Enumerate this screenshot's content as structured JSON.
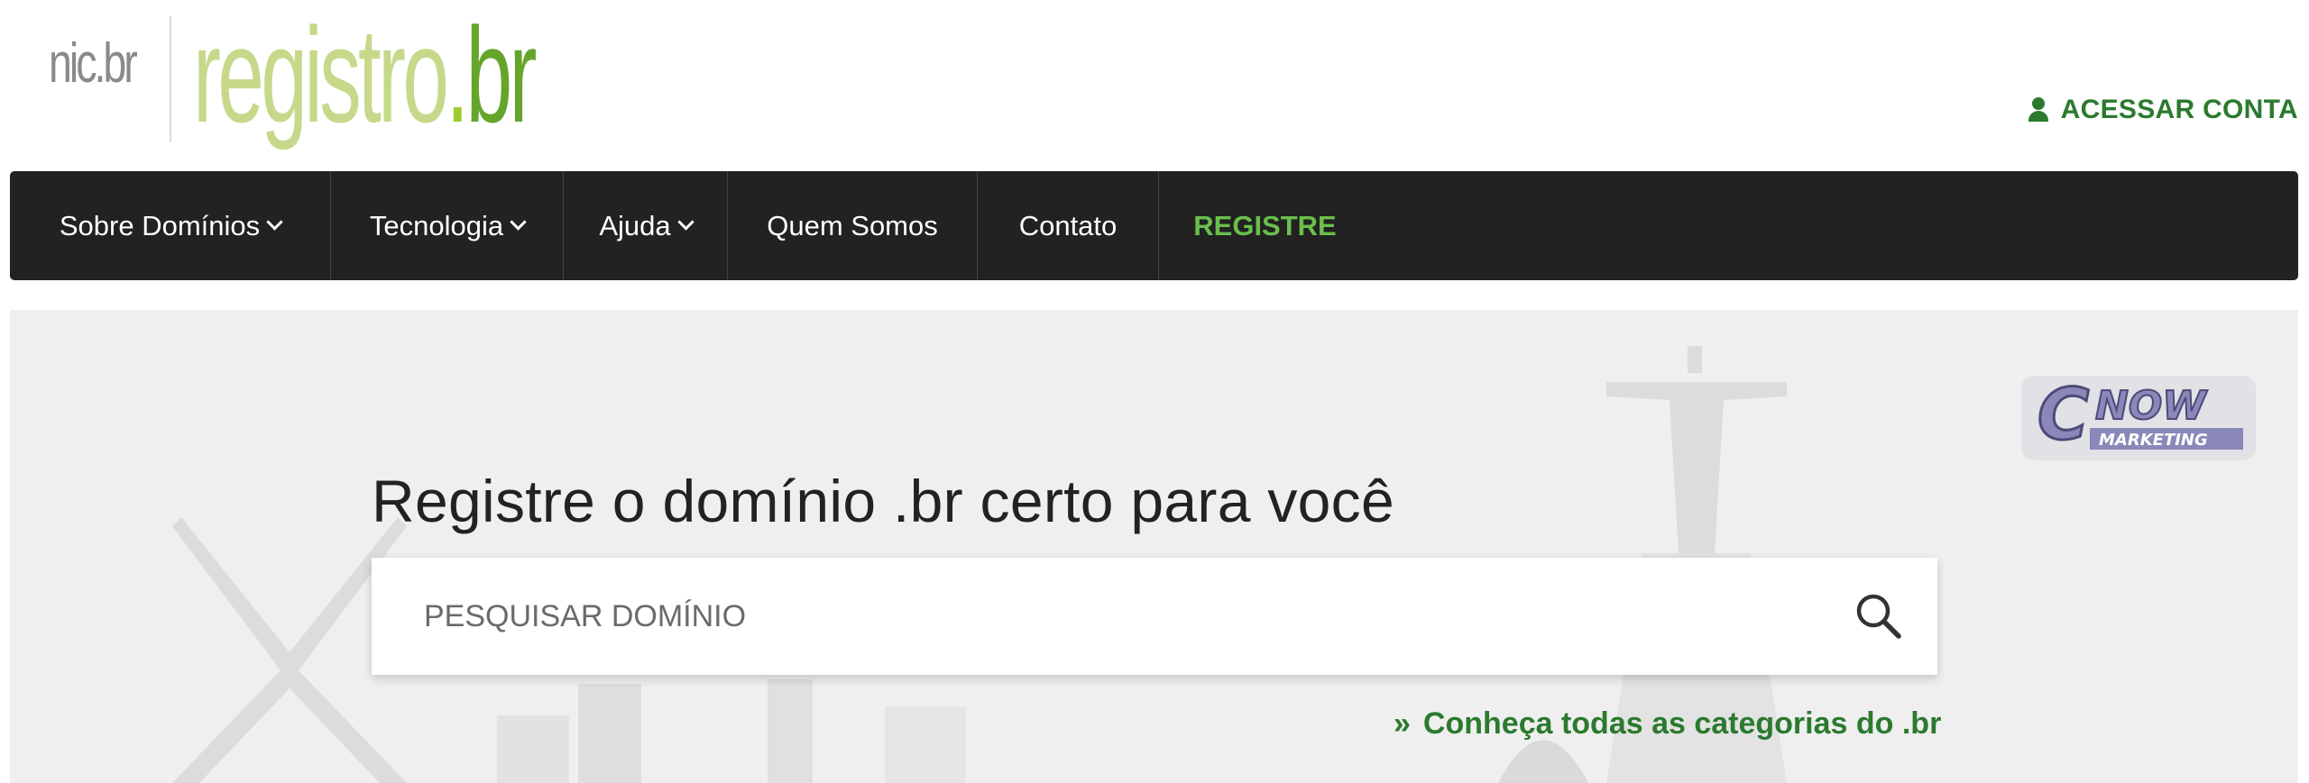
{
  "brand": {
    "nic_logo": "nic.br",
    "registro_logo_main": "registro",
    "registro_logo_dot": ".",
    "registro_logo_br": "br"
  },
  "header": {
    "account_label": "ACESSAR CONTA",
    "account_icon": "user-icon"
  },
  "nav": {
    "items": [
      {
        "label": "Sobre Domínios",
        "dropdown": true
      },
      {
        "label": "Tecnologia",
        "dropdown": true
      },
      {
        "label": "Ajuda",
        "dropdown": true
      },
      {
        "label": "Quem Somos",
        "dropdown": false
      },
      {
        "label": "Contato",
        "dropdown": false
      },
      {
        "label": "REGISTRE",
        "dropdown": false
      }
    ]
  },
  "hero": {
    "title": "Registre o domínio .br certo para você",
    "search_placeholder": "PESQUISAR DOMÍNIO",
    "search_icon": "search-icon",
    "categories_link": "Conheça todas as categorias do .br",
    "categories_prefix": "»"
  },
  "watermark": {
    "line1": "NOW",
    "line2": "MARKETING"
  },
  "colors": {
    "brand_green": "#2b7a2e",
    "nav_bg": "#222222",
    "nav_accent": "#6abf4b",
    "hero_bg": "#efefef"
  }
}
